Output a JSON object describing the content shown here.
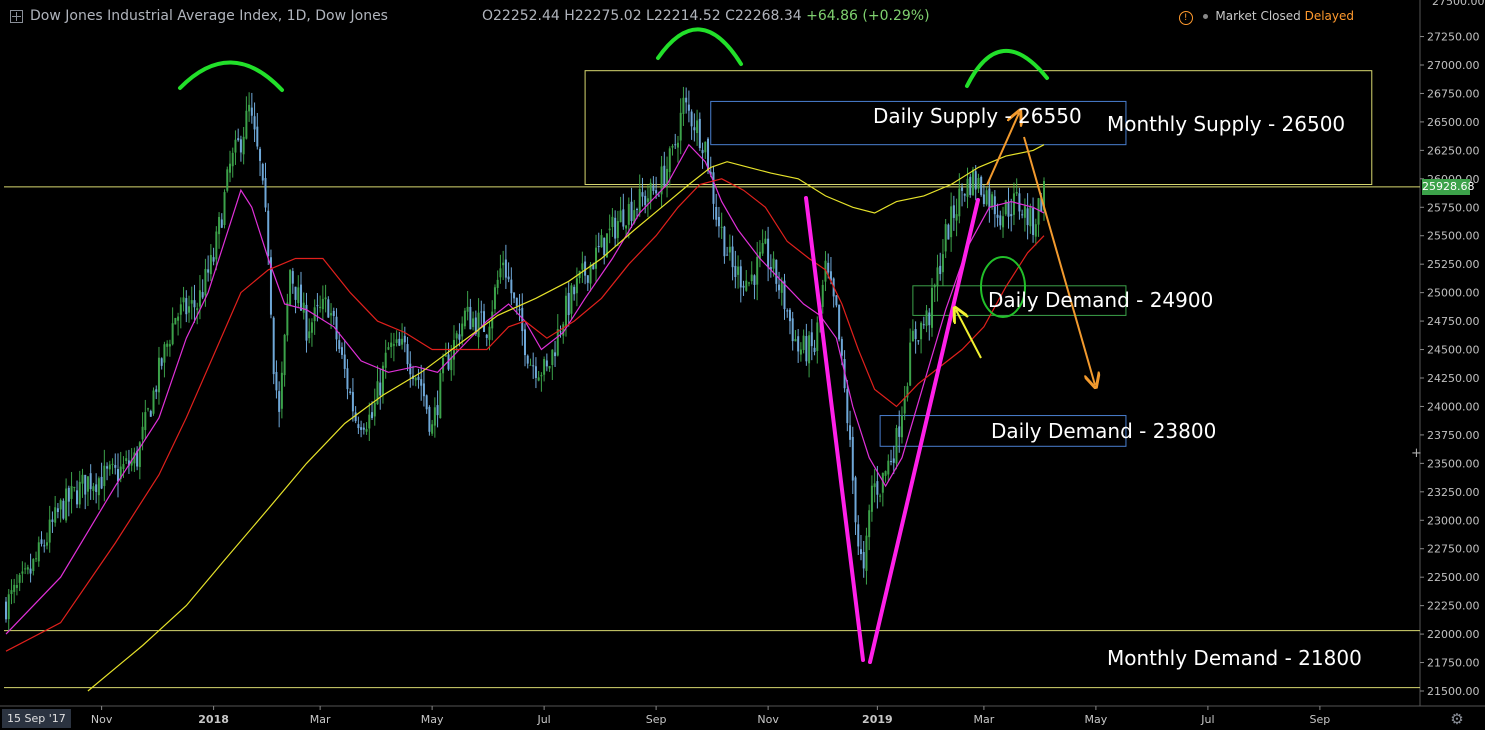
{
  "header": {
    "title": "Dow Jones Industrial Average Index, 1D, Dow Jones",
    "ohlc": "O22252.44  H22275.02  L22214.52  C22268.34",
    "change": "+64.86 (+0.29%)",
    "status": "Market Closed",
    "delayed": "Delayed"
  },
  "footer": {
    "date_badge": "15 Sep '17"
  },
  "price_badge": "25928.68",
  "y_top_label": "27500.00",
  "chart_data": {
    "type": "candlestick",
    "title": "Dow Jones Industrial Average Index, 1D, Dow Jones",
    "ylim": [
      21450,
      27550
    ],
    "y_ticks": [
      21500,
      21750,
      22000,
      22250,
      22500,
      22750,
      23000,
      23250,
      23500,
      23750,
      24000,
      24250,
      24500,
      24750,
      25000,
      25250,
      25500,
      25750,
      26000,
      26250,
      26500,
      26750,
      27000,
      27250
    ],
    "x_ticks": [
      {
        "label": "Nov",
        "i": 35
      },
      {
        "label": "2018",
        "i": 76
      },
      {
        "label": "Mar",
        "i": 115
      },
      {
        "label": "May",
        "i": 156
      },
      {
        "label": "Jul",
        "i": 197
      },
      {
        "label": "Sep",
        "i": 238
      },
      {
        "label": "Nov",
        "i": 279
      },
      {
        "label": "2019",
        "i": 319
      },
      {
        "label": "Mar",
        "i": 358
      },
      {
        "label": "May",
        "i": 399
      },
      {
        "label": "Jul",
        "i": 440
      },
      {
        "label": "Sep",
        "i": 481
      }
    ],
    "last_bar_index": 380,
    "close_path": [
      [
        0,
        22260
      ],
      [
        8,
        22500
      ],
      [
        20,
        23100
      ],
      [
        30,
        23350
      ],
      [
        40,
        23400
      ],
      [
        48,
        23550
      ],
      [
        56,
        24300
      ],
      [
        62,
        24800
      ],
      [
        70,
        24900
      ],
      [
        76,
        25300
      ],
      [
        82,
        26100
      ],
      [
        86,
        26350
      ],
      [
        89,
        26600
      ],
      [
        93,
        26100
      ],
      [
        96,
        25400
      ],
      [
        98,
        24400
      ],
      [
        100,
        23900
      ],
      [
        104,
        25200
      ],
      [
        110,
        24700
      ],
      [
        118,
        24900
      ],
      [
        124,
        24300
      ],
      [
        128,
        23900
      ],
      [
        134,
        23900
      ],
      [
        140,
        24500
      ],
      [
        146,
        24500
      ],
      [
        152,
        24200
      ],
      [
        156,
        23800
      ],
      [
        160,
        24300
      ],
      [
        168,
        24800
      ],
      [
        176,
        24700
      ],
      [
        182,
        25300
      ],
      [
        186,
        24900
      ],
      [
        192,
        24400
      ],
      [
        198,
        24300
      ],
      [
        204,
        24800
      ],
      [
        210,
        25100
      ],
      [
        218,
        25400
      ],
      [
        226,
        25700
      ],
      [
        232,
        25800
      ],
      [
        238,
        25900
      ],
      [
        244,
        26200
      ],
      [
        248,
        26650
      ],
      [
        252,
        26500
      ],
      [
        256,
        26300
      ],
      [
        260,
        25700
      ],
      [
        266,
        25200
      ],
      [
        272,
        25100
      ],
      [
        278,
        25350
      ],
      [
        284,
        25000
      ],
      [
        290,
        24500
      ],
      [
        296,
        24500
      ],
      [
        300,
        25200
      ],
      [
        304,
        24800
      ],
      [
        308,
        23900
      ],
      [
        312,
        22800
      ],
      [
        314,
        22500
      ],
      [
        317,
        23300
      ],
      [
        320,
        23300
      ],
      [
        326,
        23700
      ],
      [
        332,
        24600
      ],
      [
        338,
        24800
      ],
      [
        344,
        25500
      ],
      [
        350,
        25900
      ],
      [
        354,
        26000
      ],
      [
        358,
        25900
      ],
      [
        364,
        25700
      ],
      [
        370,
        25800
      ],
      [
        376,
        25600
      ],
      [
        380,
        25900
      ]
    ],
    "moving_averages": [
      {
        "color": "#e030d8",
        "points": [
          [
            0,
            22000
          ],
          [
            20,
            22500
          ],
          [
            40,
            23300
          ],
          [
            56,
            23900
          ],
          [
            66,
            24600
          ],
          [
            74,
            25000
          ],
          [
            82,
            25600
          ],
          [
            86,
            25900
          ],
          [
            90,
            25750
          ],
          [
            96,
            25300
          ],
          [
            102,
            24900
          ],
          [
            110,
            24850
          ],
          [
            120,
            24700
          ],
          [
            130,
            24400
          ],
          [
            140,
            24300
          ],
          [
            150,
            24350
          ],
          [
            158,
            24300
          ],
          [
            166,
            24500
          ],
          [
            176,
            24750
          ],
          [
            184,
            24900
          ],
          [
            190,
            24750
          ],
          [
            196,
            24500
          ],
          [
            204,
            24650
          ],
          [
            212,
            24950
          ],
          [
            222,
            25300
          ],
          [
            232,
            25700
          ],
          [
            242,
            25950
          ],
          [
            250,
            26300
          ],
          [
            256,
            26150
          ],
          [
            262,
            25800
          ],
          [
            268,
            25550
          ],
          [
            276,
            25300
          ],
          [
            284,
            25100
          ],
          [
            292,
            24900
          ],
          [
            298,
            24800
          ],
          [
            304,
            24600
          ],
          [
            310,
            24000
          ],
          [
            316,
            23550
          ],
          [
            322,
            23300
          ],
          [
            328,
            23550
          ],
          [
            336,
            24200
          ],
          [
            344,
            24850
          ],
          [
            352,
            25400
          ],
          [
            360,
            25750
          ],
          [
            368,
            25800
          ],
          [
            376,
            25750
          ],
          [
            380,
            25700
          ]
        ]
      },
      {
        "color": "#e0201c",
        "points": [
          [
            0,
            21850
          ],
          [
            20,
            22100
          ],
          [
            40,
            22800
          ],
          [
            56,
            23400
          ],
          [
            66,
            23900
          ],
          [
            76,
            24450
          ],
          [
            86,
            25000
          ],
          [
            96,
            25200
          ],
          [
            106,
            25300
          ],
          [
            116,
            25300
          ],
          [
            126,
            25000
          ],
          [
            136,
            24750
          ],
          [
            146,
            24650
          ],
          [
            156,
            24500
          ],
          [
            166,
            24500
          ],
          [
            176,
            24500
          ],
          [
            184,
            24700
          ],
          [
            190,
            24750
          ],
          [
            198,
            24600
          ],
          [
            208,
            24750
          ],
          [
            218,
            24950
          ],
          [
            228,
            25250
          ],
          [
            238,
            25500
          ],
          [
            246,
            25750
          ],
          [
            254,
            25950
          ],
          [
            262,
            26000
          ],
          [
            270,
            25900
          ],
          [
            278,
            25750
          ],
          [
            286,
            25450
          ],
          [
            294,
            25300
          ],
          [
            300,
            25200
          ],
          [
            306,
            24900
          ],
          [
            312,
            24500
          ],
          [
            318,
            24150
          ],
          [
            326,
            24000
          ],
          [
            334,
            24200
          ],
          [
            342,
            24350
          ],
          [
            350,
            24500
          ],
          [
            358,
            24700
          ],
          [
            366,
            25050
          ],
          [
            374,
            25350
          ],
          [
            380,
            25500
          ]
        ]
      },
      {
        "color": "#e6e22a",
        "points": [
          [
            30,
            21500
          ],
          [
            50,
            21900
          ],
          [
            66,
            22250
          ],
          [
            80,
            22650
          ],
          [
            96,
            23100
          ],
          [
            110,
            23500
          ],
          [
            124,
            23850
          ],
          [
            138,
            24100
          ],
          [
            152,
            24300
          ],
          [
            166,
            24550
          ],
          [
            180,
            24800
          ],
          [
            194,
            24950
          ],
          [
            206,
            25100
          ],
          [
            218,
            25300
          ],
          [
            230,
            25550
          ],
          [
            240,
            25750
          ],
          [
            250,
            25950
          ],
          [
            258,
            26100
          ],
          [
            264,
            26150
          ],
          [
            272,
            26100
          ],
          [
            280,
            26050
          ],
          [
            290,
            26000
          ],
          [
            300,
            25850
          ],
          [
            310,
            25750
          ],
          [
            318,
            25700
          ],
          [
            326,
            25800
          ],
          [
            336,
            25850
          ],
          [
            346,
            25950
          ],
          [
            356,
            26100
          ],
          [
            366,
            26200
          ],
          [
            376,
            26250
          ],
          [
            380,
            26300
          ]
        ]
      }
    ],
    "annotations": {
      "labels": [
        {
          "text": "Daily Supply - 26550",
          "price": 26550
        },
        {
          "text": "Monthly Supply - 26500",
          "price": 26500
        },
        {
          "text": "Daily Demand - 24900",
          "price": 24900
        },
        {
          "text": "Daily Demand - 23800",
          "price": 23800
        },
        {
          "text": "Monthly Demand - 21800",
          "price": 21800
        }
      ],
      "horizontal_levels": [
        25928.68,
        22030,
        21530
      ],
      "boxes": [
        {
          "name": "monthly-supply-zone",
          "i0": 212,
          "i1": 500,
          "p0": 25950,
          "p1": 26950,
          "color": "#d8d870"
        },
        {
          "name": "daily-supply-zone",
          "i0": 258,
          "i1": 410,
          "p0": 26300,
          "p1": 26680,
          "color": "#4a7fd0"
        },
        {
          "name": "daily-demand-zone-1",
          "i0": 332,
          "i1": 410,
          "p0": 24800,
          "p1": 25060,
          "color": "#3ca24a"
        },
        {
          "name": "daily-demand-zone-2",
          "i0": 320,
          "i1": 410,
          "p0": 23650,
          "p1": 23920,
          "color": "#4a7fd0"
        }
      ],
      "colors": {
        "arcs": "#22e02a",
        "v_lines": "#ff20e8",
        "arrows_orange": "#f29a2e",
        "arrow_yellow": "#f0f030",
        "ellipse": "#22c02a",
        "candle_up": "#3ca24a",
        "candle_down": "#6fa8d8"
      }
    }
  }
}
